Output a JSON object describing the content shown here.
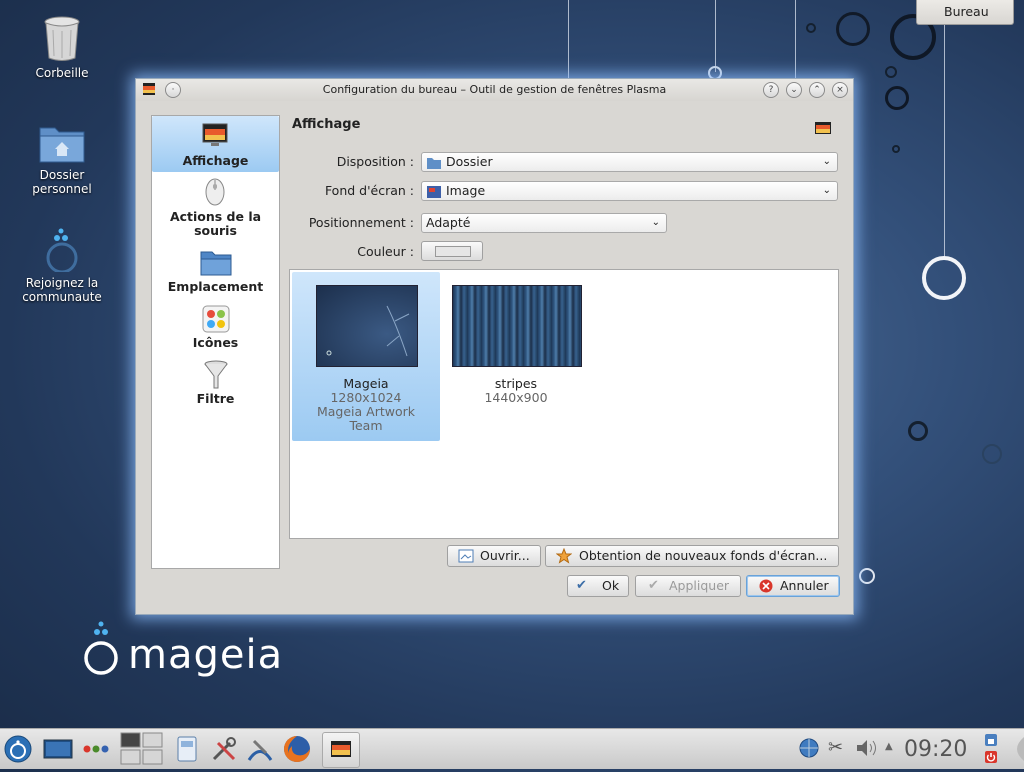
{
  "desktop": {
    "icons": [
      {
        "label": "Corbeille"
      },
      {
        "label": "Dossier\npersonnel"
      },
      {
        "label": "Rejoignez la\ncommunaute"
      }
    ],
    "corner_label": "Bureau",
    "brand": "mageia"
  },
  "window": {
    "title": "Configuration du bureau – Outil de gestion de fenêtres Plasma",
    "help": "?",
    "section_heading": "Affichage",
    "sidebar": [
      {
        "label": "Affichage",
        "selected": true
      },
      {
        "label": "Actions de la souris"
      },
      {
        "label": "Emplacement"
      },
      {
        "label": "Icônes"
      },
      {
        "label": "Filtre"
      }
    ],
    "form": {
      "disposition_label": "Disposition :",
      "disposition_value": "Dossier",
      "fond_label": "Fond d'écran :",
      "fond_value": "Image",
      "position_label": "Positionnement :",
      "position_value": "Adapté",
      "couleur_label": "Couleur :"
    },
    "wallpapers": [
      {
        "name": "Mageia",
        "size": "1280x1024",
        "author": "Mageia Artwork Team",
        "selected": true
      },
      {
        "name": "stripes",
        "size": "1440x900",
        "author": ""
      }
    ],
    "buttons": {
      "open": "Ouvrir...",
      "get_new": "Obtention de nouveaux fonds d'écran...",
      "ok": "Ok",
      "apply": "Appliquer",
      "cancel": "Annuler"
    }
  },
  "taskbar": {
    "clock": "09:20"
  },
  "colors": {
    "accent": "#9ccaf2",
    "desktop_bg": "#33507a",
    "window_bg": "#d9d7d3"
  }
}
